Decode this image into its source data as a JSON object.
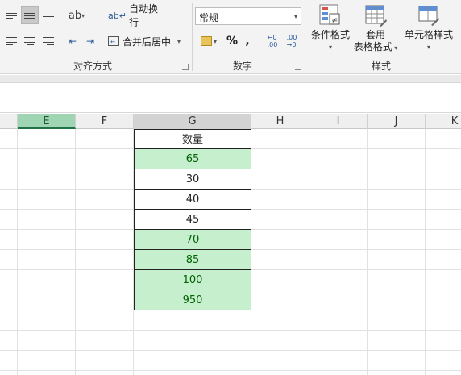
{
  "ribbon": {
    "alignment": {
      "group_label": "对齐方式",
      "wrap_text": "自动换行",
      "merge_center": "合并后居中"
    },
    "number": {
      "group_label": "数字",
      "format_value": "常规",
      "percent": "%",
      "comma": ",",
      "inc_decimal": "←0\n.00",
      "dec_decimal": ".00\n→0"
    },
    "styles": {
      "group_label": "样式",
      "conditional": "条件格式",
      "table_line1": "套用",
      "table_line2": "表格格式",
      "cell_styles": "单元格样式"
    }
  },
  "columns": [
    "E",
    "F",
    "G",
    "H",
    "I",
    "J",
    "K"
  ],
  "selected_column": "E",
  "table": {
    "header": "数量",
    "rows": [
      {
        "value": "65",
        "highlight": true
      },
      {
        "value": "30",
        "highlight": false
      },
      {
        "value": "40",
        "highlight": false
      },
      {
        "value": "45",
        "highlight": false
      },
      {
        "value": "70",
        "highlight": true
      },
      {
        "value": "85",
        "highlight": true
      },
      {
        "value": "100",
        "highlight": true
      },
      {
        "value": "950",
        "highlight": true
      }
    ]
  },
  "colors": {
    "highlight_fill": "#c6efce",
    "highlight_text": "#006100",
    "selected_header": "#9fd5b3"
  }
}
